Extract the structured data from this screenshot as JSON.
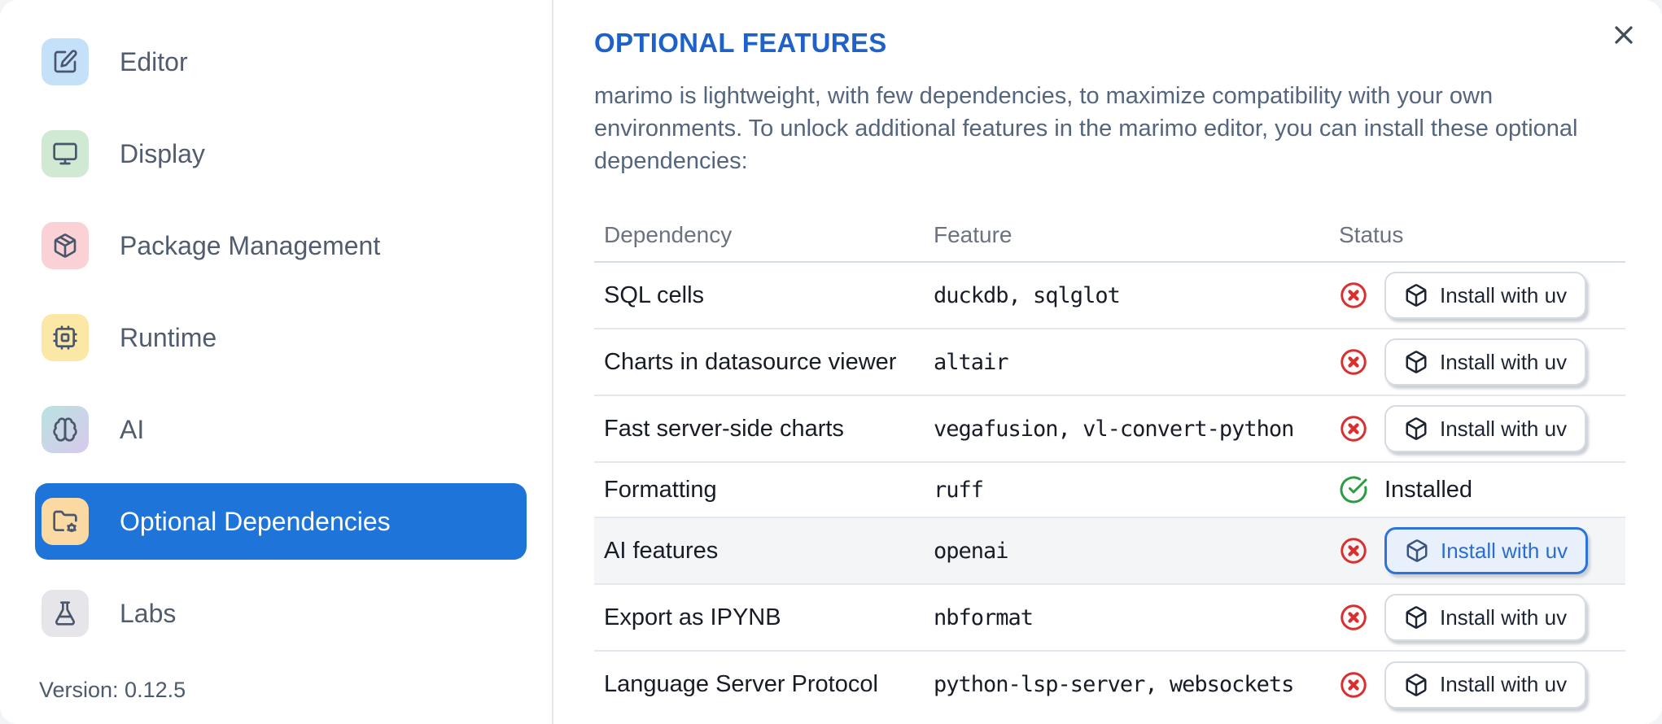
{
  "sidebar": {
    "items": [
      {
        "label": "Editor",
        "icon": "square-pen-icon",
        "bg": "#c5e1fa"
      },
      {
        "label": "Display",
        "icon": "monitor-icon",
        "bg": "#cfe9d2"
      },
      {
        "label": "Package Management",
        "icon": "package-icon",
        "bg": "#fad2d6"
      },
      {
        "label": "Runtime",
        "icon": "cpu-icon",
        "bg": "#fbe8a6"
      },
      {
        "label": "AI",
        "icon": "brain-icon",
        "bg": "#b9e3df",
        "bg2": "#d9c8ee"
      },
      {
        "label": "Optional Dependencies",
        "icon": "folder-cog-icon",
        "bg": "#fbd9a3",
        "selected": true
      },
      {
        "label": "Labs",
        "icon": "flask-icon",
        "bg": "#e6e6ea"
      }
    ],
    "selected_bg": "#1e74d8",
    "version_label": "Version: 0.12.5"
  },
  "panel": {
    "title": "OPTIONAL FEATURES",
    "title_color": "#1d61c9",
    "description": "marimo is lightweight, with few dependencies, to maximize compatibility with your own environments. To unlock additional features in the marimo editor, you can install these optional dependencies:",
    "close_icon": "x-icon",
    "table": {
      "headers": [
        "Dependency",
        "Feature",
        "Status"
      ],
      "status_colors": {
        "not_installed": "#d92f2f",
        "installed": "#2a9c43"
      },
      "rows": [
        {
          "dependency": "SQL cells",
          "feature": "duckdb, sqlglot",
          "status": "not_installed",
          "status_icon": "circle-x-icon",
          "action": "Install with uv",
          "action_icon": "box-icon"
        },
        {
          "dependency": "Charts in datasource viewer",
          "feature": "altair",
          "status": "not_installed",
          "status_icon": "circle-x-icon",
          "action": "Install with uv",
          "action_icon": "box-icon"
        },
        {
          "dependency": "Fast server-side charts",
          "feature": "vegafusion, vl-convert-python",
          "status": "not_installed",
          "status_icon": "circle-x-icon",
          "action": "Install with uv",
          "action_icon": "box-icon"
        },
        {
          "dependency": "Formatting",
          "feature": "ruff",
          "status": "installed",
          "status_icon": "circle-check-icon",
          "status_label": "Installed"
        },
        {
          "dependency": "AI features",
          "feature": "openai",
          "status": "not_installed",
          "status_icon": "circle-x-icon",
          "action": "Install with uv",
          "action_icon": "box-icon",
          "highlighted": true,
          "action_focused": true
        },
        {
          "dependency": "Export as IPYNB",
          "feature": "nbformat",
          "status": "not_installed",
          "status_icon": "circle-x-icon",
          "action": "Install with uv",
          "action_icon": "box-icon"
        },
        {
          "dependency": "Language Server Protocol",
          "feature": "python-lsp-server, websockets",
          "status": "not_installed",
          "status_icon": "circle-x-icon",
          "action": "Install with uv",
          "action_icon": "box-icon"
        }
      ]
    }
  }
}
